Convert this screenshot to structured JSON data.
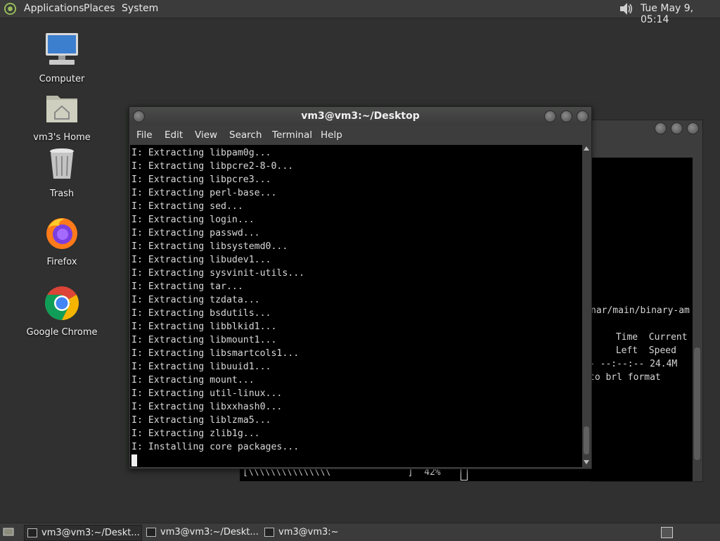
{
  "top_panel": {
    "menus": [
      "Applications",
      "Places",
      "System"
    ],
    "clock": "Tue May 9, 05:14"
  },
  "desktop_icons": [
    {
      "label": "Computer",
      "icon": "computer-icon"
    },
    {
      "label": "vm3's Home",
      "icon": "home-folder-icon"
    },
    {
      "label": "Trash",
      "icon": "trash-icon"
    },
    {
      "label": "Firefox",
      "icon": "firefox-icon"
    },
    {
      "label": "Google Chrome",
      "icon": "chrome-icon"
    }
  ],
  "terminal": {
    "title": "vm3@vm3:~/Desktop",
    "menu": [
      "File",
      "Edit",
      "View",
      "Search",
      "Terminal",
      "Help"
    ],
    "lines": [
      "I: Extracting libpam0g...",
      "I: Extracting libpcre2-8-0...",
      "I: Extracting libpcre3...",
      "I: Extracting perl-base...",
      "I: Extracting sed...",
      "I: Extracting login...",
      "I: Extracting passwd...",
      "I: Extracting libsystemd0...",
      "I: Extracting libudev1...",
      "I: Extracting sysvinit-utils...",
      "I: Extracting tar...",
      "I: Extracting tzdata...",
      "I: Extracting bsdutils...",
      "I: Extracting libblkid1...",
      "I: Extracting libmount1...",
      "I: Extracting libsmartcols1...",
      "I: Extracting libuuid1...",
      "I: Extracting mount...",
      "I: Extracting util-linux...",
      "I: Extracting libxxhash0...",
      "I: Extracting liblzma5...",
      "I: Extracting zlib1g...",
      "I: Installing core packages..."
    ]
  },
  "back_terminal": {
    "lines": [
      "nar/main/binary-am",
      "",
      " Time  Current",
      " Left  Speed",
      "- --:--:-- 24.4M",
      "to brl format"
    ],
    "progress": "[\\\\\\\\\\\\\\\\\\\\\\\\\\\\\\              ]  42%"
  },
  "taskbar": {
    "tasks": [
      "vm3@vm3:~/Deskt...",
      "vm3@vm3:~/Deskt...",
      "vm3@vm3:~"
    ]
  }
}
